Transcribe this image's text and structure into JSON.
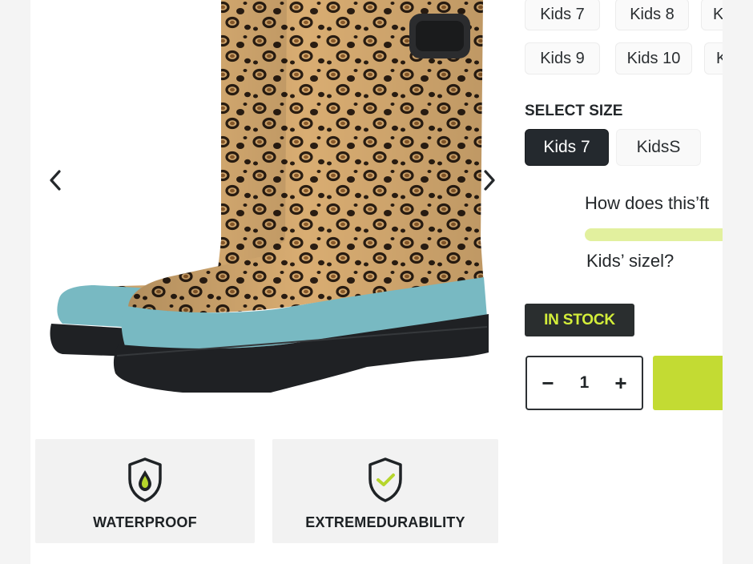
{
  "gallery": {
    "prev_icon": "chevron-left-icon",
    "next_icon": "chevron-right-icon",
    "features": [
      {
        "label": "WATERPROOF",
        "icon": "shield-water-drop-icon"
      },
      {
        "label": "EXTREMEDURABILITY",
        "icon": "shield-check-icon"
      }
    ]
  },
  "sizes": {
    "chips_row1": [
      "Kids 7",
      "Kids 8",
      "K"
    ],
    "chips_row2": [
      "Kids 9",
      "Kids 10",
      "K"
    ],
    "section_title": "SELECT SIZE",
    "selected": "Kids 7",
    "other": "KidsS"
  },
  "fit": {
    "question": "How does this’ft",
    "subtext": "Kids’ sizel?"
  },
  "stock": {
    "label": "IN STOCK"
  },
  "quantity": {
    "minus": "−",
    "value": "1",
    "plus": "+"
  },
  "colors": {
    "accent": "#c3db33",
    "badge_text": "#d4ee3a",
    "dark": "#24292e",
    "fit_track": "#e2f09e",
    "boot_teal": "#78b9c2",
    "leopard_base": "#d9ad72"
  }
}
